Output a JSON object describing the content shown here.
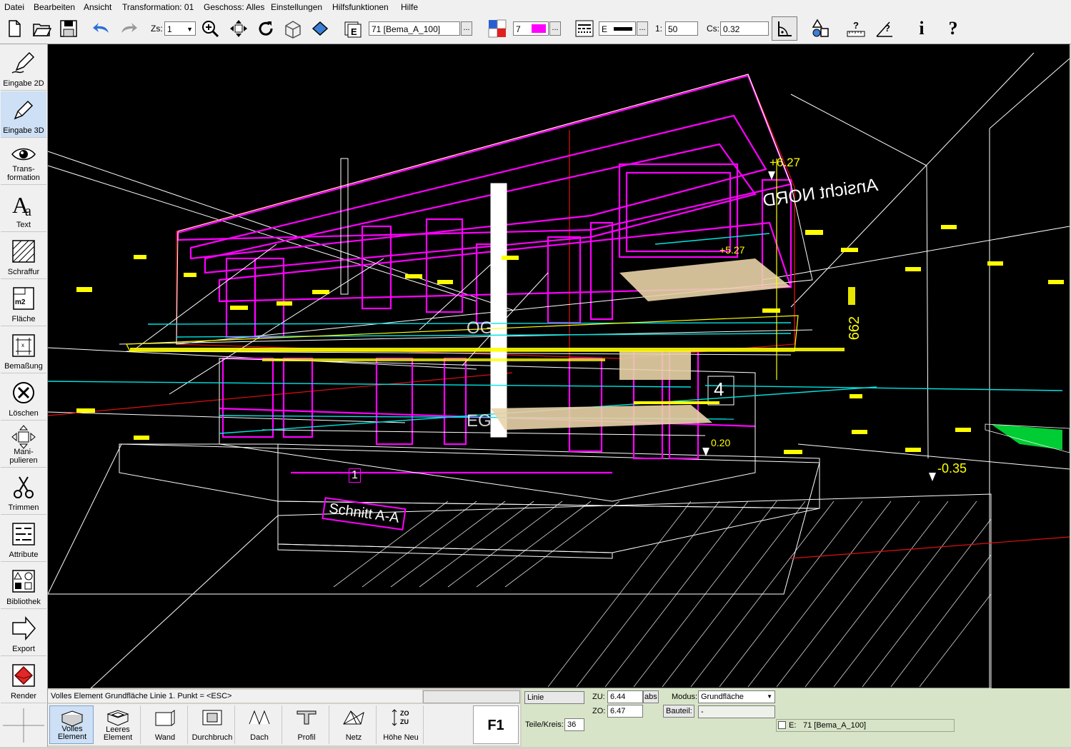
{
  "menu": [
    "Datei",
    "Bearbeiten",
    "Ansicht",
    "Transformation: 01",
    "Geschoss: Alles",
    "Einstellungen",
    "Hilfsfunktionen",
    "Hilfe"
  ],
  "toolbar": {
    "zs_label": "Zs:",
    "zs_value": "1",
    "layer_value": "71 [Bema_A_100]",
    "layer_dots": "...",
    "color_value": "7",
    "color_dots": "...",
    "pen_prefix": "E",
    "pen_dots": "...",
    "scale_label": "1:",
    "scale_value": "50",
    "cs_label": "Cs:",
    "cs_value": "0.32",
    "info_glyph": "i",
    "help_glyph": "?"
  },
  "sidebar": [
    {
      "label": "Eingabe 2D",
      "icon": "pen-2d-icon"
    },
    {
      "label": "Eingabe 3D",
      "icon": "pen-3d-icon"
    },
    {
      "label": "Trans-\nformation",
      "icon": "eye-icon"
    },
    {
      "label": "Text",
      "icon": "text-icon"
    },
    {
      "label": "Schraffur",
      "icon": "hatch-icon"
    },
    {
      "label": "Fläche",
      "icon": "area-icon"
    },
    {
      "label": "Bemaßung",
      "icon": "dimension-icon"
    },
    {
      "label": "Löschen",
      "icon": "delete-icon"
    },
    {
      "label": "Mani-\npulieren",
      "icon": "move-icon"
    },
    {
      "label": "Trimmen",
      "icon": "scissors-icon"
    },
    {
      "label": "Attribute",
      "icon": "attributes-icon"
    },
    {
      "label": "Bibliothek",
      "icon": "library-icon"
    },
    {
      "label": "Export",
      "icon": "export-icon"
    },
    {
      "label": "Render",
      "icon": "render-icon"
    }
  ],
  "viewport": {
    "labels": {
      "ansicht": "Ansicht NORD",
      "schnitt": "Schnitt A-A",
      "dim_627": "+6.27",
      "dim_035": "-0.35",
      "dim_662": "662",
      "dim_527": "+5.27",
      "num_4": "4",
      "num_1": "1",
      "og": "OG",
      "eg": "EG",
      "dim_020": "0.20"
    }
  },
  "status": {
    "command": "Volles Element Grundfläche Linie 1. Punkt = <ESC>"
  },
  "subtools": [
    {
      "label": "Volles\nElement",
      "icon": "full-element-icon",
      "active": true
    },
    {
      "label": "Leeres\nElement",
      "icon": "empty-element-icon",
      "active": false
    },
    {
      "label": "Wand",
      "icon": "wall-icon",
      "active": false
    },
    {
      "label": "Durchbruch",
      "icon": "opening-icon",
      "active": false
    },
    {
      "label": "Dach",
      "icon": "roof-icon",
      "active": false
    },
    {
      "label": "Profil",
      "icon": "profile-icon",
      "active": false
    },
    {
      "label": "Netz",
      "icon": "mesh-icon",
      "active": false
    },
    {
      "label": "Höhe Neu",
      "icon": "height-icon",
      "active": false
    }
  ],
  "f1": "F1",
  "props": {
    "type_value": "Linie",
    "zu_label": "ZU:",
    "zu_value": "6.44",
    "abs_label": "abs",
    "zo_label": "ZO:",
    "zo_value": "6.47",
    "modus_label": "Modus:",
    "modus_value": "Grundfläche",
    "bauteil_label": "Bauteil:",
    "bauteil_value": "-",
    "teile_label": "Teile/Kreis:",
    "teile_value": "36",
    "e_label": "E:",
    "e_value": "71 [Bema_A_100]"
  },
  "colors": {
    "magenta": "#ff00ff",
    "yellow": "#ffff00",
    "cyan": "#00e5e5",
    "red": "#e01010",
    "white": "#ffffff",
    "green": "#00cc33"
  }
}
